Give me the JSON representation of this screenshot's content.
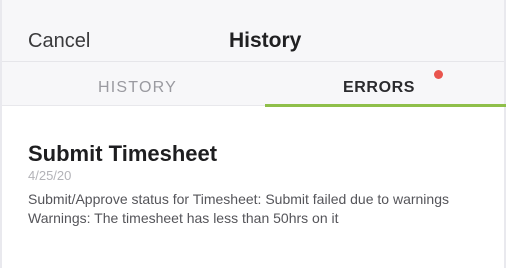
{
  "nav": {
    "cancel_label": "Cancel",
    "title": "History"
  },
  "tabs": [
    {
      "label": "HISTORY",
      "selected": false
    },
    {
      "label": "ERRORS",
      "selected": true,
      "has_badge": true
    }
  ],
  "colors": {
    "accent_indicator": "#8fbf4a",
    "badge": "#e9554e"
  },
  "entry": {
    "title": "Submit Timesheet",
    "date": "4/25/20",
    "message_line1": "Submit/Approve status for Timesheet: Submit failed due to warnings",
    "message_line2": "Warnings: The timesheet has less than 50hrs on it"
  }
}
